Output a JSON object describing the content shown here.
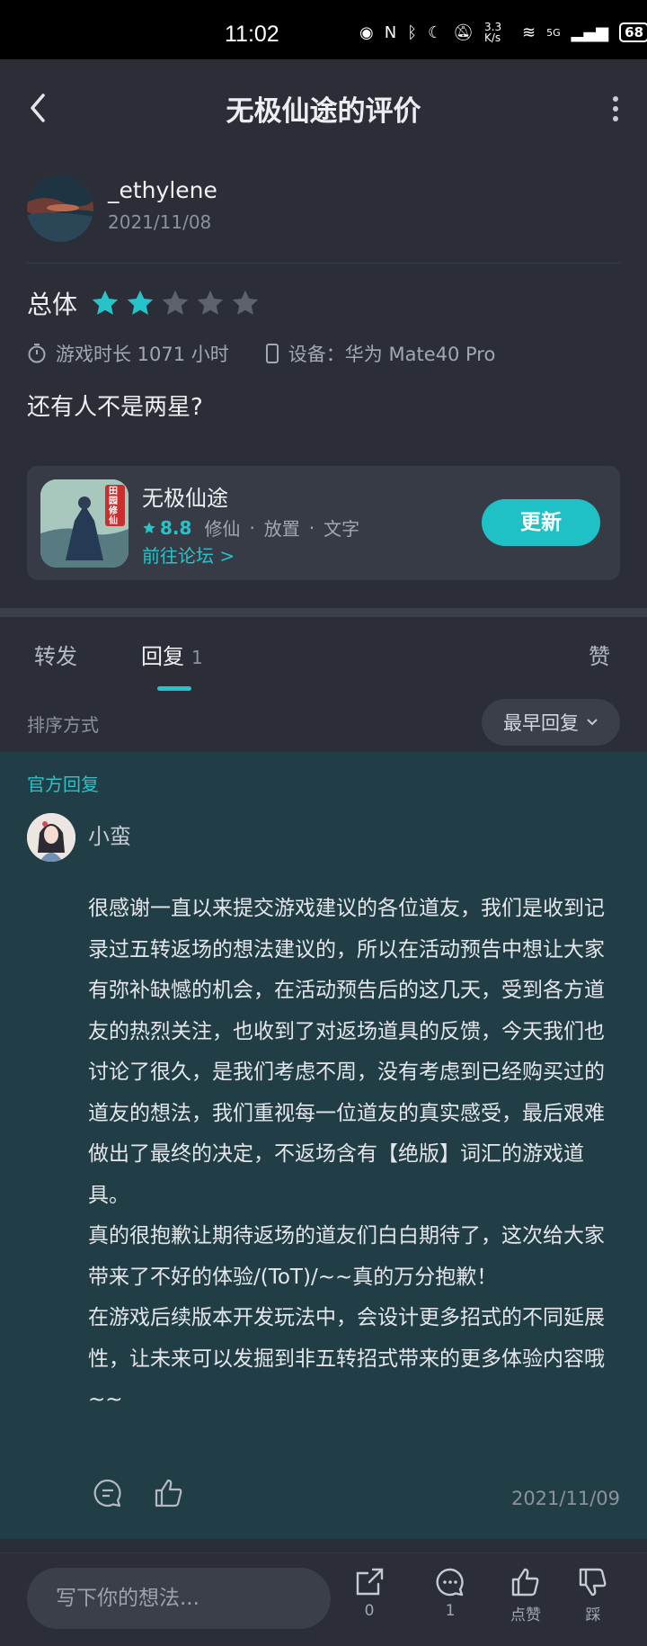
{
  "status_bar": {
    "time": "11:02",
    "net_speed": "3.3 K/s",
    "signal": "5G",
    "battery": "68"
  },
  "header": {
    "title": "无极仙途的评价"
  },
  "review": {
    "username": "_ethylene",
    "date": "2021/11/08",
    "rating_label": "总体",
    "rating": 2,
    "rating_max": 5,
    "playtime": "游戏时长 1071 小时",
    "device": "设备：华为 Mate40 Pro",
    "text": "还有人不是两星?"
  },
  "game_card": {
    "name": "无极仙途",
    "icon_text": "田园修仙",
    "score": "8.8",
    "tags": [
      "修仙",
      "放置",
      "文字"
    ],
    "forum_link": "前往论坛 >",
    "update_label": "更新"
  },
  "tabs": [
    {
      "label": "转发",
      "count": ""
    },
    {
      "label": "回复",
      "count": "1"
    },
    {
      "label": "赞",
      "count": ""
    }
  ],
  "sort": {
    "label": "排序方式",
    "value": "最早回复"
  },
  "official_reply": {
    "tag": "官方回复",
    "name": "小蛮",
    "body": "很感谢一直以来提交游戏建议的各位道友，我们是收到记录过五转返场的想法建议的，所以在活动预告中想让大家有弥补缺憾的机会，在活动预告后的这几天，受到各方道友的热烈关注，也收到了对返场道具的反馈，今天我们也讨论了很久，是我们考虑不周，没有考虑到已经购买过的道友的想法，我们重视每一位道友的真实感受，最后艰难做出了最终的决定，不返场含有【绝版】词汇的游戏道具。\n真的很抱歉让期待返场的道友们白白期待了，这次给大家带来了不好的体验/(ToT)/~~真的万分抱歉！\n在游戏后续版本开发玩法中，会设计更多招式的不同延展性，让未来可以发掘到非五转招式带来的更多体验内容哦~~",
    "date": "2021/11/09"
  },
  "bottom_bar": {
    "placeholder": "写下你的想法...",
    "share_count": "0",
    "comment_count": "1",
    "like_label": "点赞",
    "dislike_label": "踩"
  },
  "colors": {
    "accent": "#27c3c9",
    "background": "#2b2e37",
    "official_bg": "#213e47"
  }
}
